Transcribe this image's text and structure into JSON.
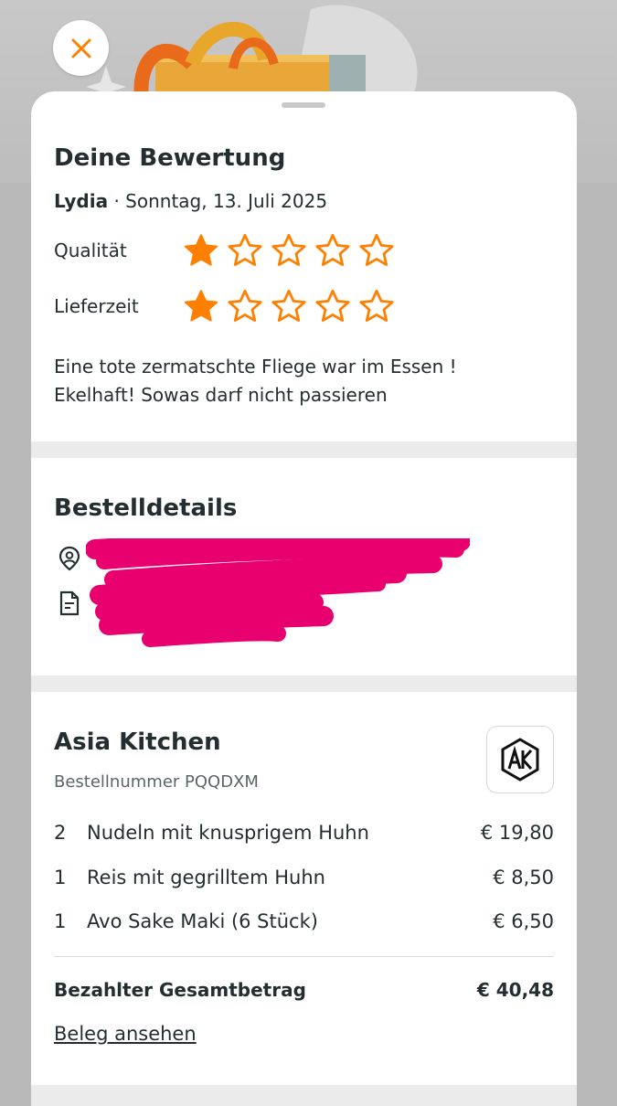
{
  "colors": {
    "accent_orange": "#ff8000",
    "redaction_pink": "#e8006f",
    "text_dark": "#242e30",
    "text_muted": "#5b6568"
  },
  "header": {
    "close_icon": "close-icon"
  },
  "review": {
    "title": "Deine Bewertung",
    "author": "Lydia",
    "separator": " · ",
    "date": "Sonntag, 13. Juli 2025",
    "ratings": [
      {
        "label": "Qualität",
        "stars": 1,
        "max": 5
      },
      {
        "label": "Lieferzeit",
        "stars": 1,
        "max": 5
      }
    ],
    "comment_line1": "Eine tote zermatschte Fliege war im Essen !",
    "comment_line2": "Ekelhaft! Sowas darf nicht passieren"
  },
  "details": {
    "title": "Bestelldetails",
    "icons": [
      "location-pin-icon",
      "note-icon"
    ]
  },
  "order": {
    "restaurant": "Asia Kitchen",
    "order_number": "Bestellnummer PQQDXM",
    "items": [
      {
        "qty": "2",
        "name": "Nudeln mit knusprigem Huhn",
        "price": "€ 19,80"
      },
      {
        "qty": "1",
        "name": "Reis mit gegrilltem Huhn",
        "price": "€ 8,50"
      },
      {
        "qty": "1",
        "name": "Avo Sake Maki (6 Stück)",
        "price": "€ 6,50"
      }
    ],
    "total_label": "Bezahlter Gesamtbetrag",
    "total_value": "€ 40,48",
    "receipt_link": "Beleg ansehen"
  }
}
